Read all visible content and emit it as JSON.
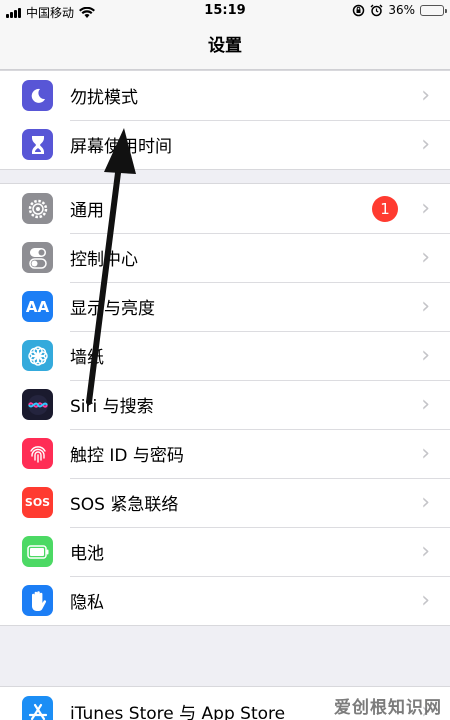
{
  "status": {
    "carrier": "中国移动",
    "time": "15:19",
    "battery_percent": "36%",
    "battery_level": 0.36
  },
  "nav": {
    "title": "设置"
  },
  "groups": [
    [
      {
        "label": "勿扰模式",
        "icon": "moon-icon",
        "color": "#5856d6"
      },
      {
        "label": "屏幕使用时间",
        "icon": "hourglass-icon",
        "color": "#5856d6"
      }
    ],
    [
      {
        "label": "通用",
        "icon": "gear-icon",
        "color": "#8e8e93",
        "badge": "1"
      },
      {
        "label": "控制中心",
        "icon": "toggle-icon",
        "color": "#8e8e93"
      },
      {
        "label": "显示与亮度",
        "icon": "text-size-icon",
        "color": "#1c7ef5",
        "glyph": "AA"
      },
      {
        "label": "墙纸",
        "icon": "flower-icon",
        "color": "#34aadc"
      },
      {
        "label": "Siri 与搜索",
        "icon": "siri-icon",
        "color": "#1a1a2e"
      },
      {
        "label": "触控 ID 与密码",
        "icon": "fingerprint-icon",
        "color": "#ff2d55"
      },
      {
        "label": "SOS 紧急联络",
        "icon": "sos-icon",
        "color": "#ff3b30",
        "glyph": "SOS"
      },
      {
        "label": "电池",
        "icon": "battery-icon",
        "color": "#4cd964"
      },
      {
        "label": "隐私",
        "icon": "hand-icon",
        "color": "#1c7ef5"
      }
    ],
    [
      {
        "label": "iTunes Store 与 App Store",
        "icon": "app-store-icon",
        "color": "#1c8ef5"
      }
    ]
  ],
  "watermark": "爱创根知识网"
}
